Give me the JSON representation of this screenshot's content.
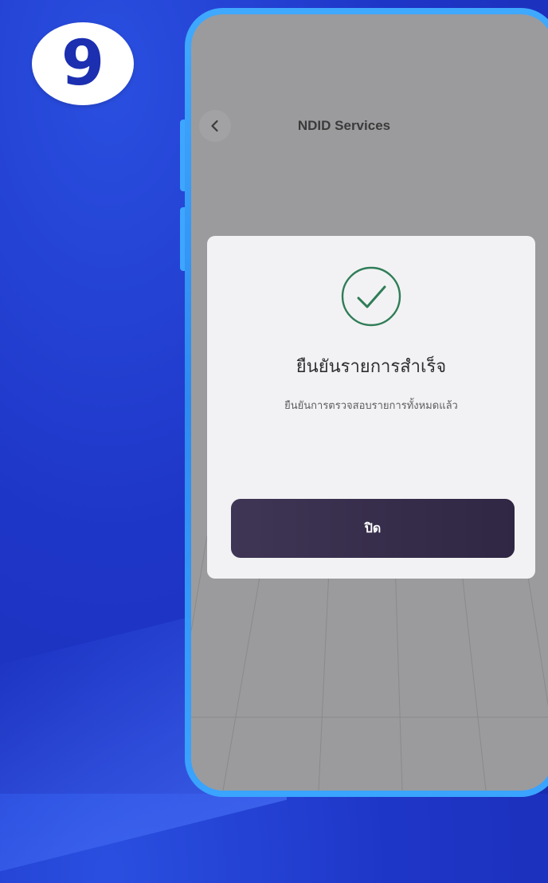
{
  "step": {
    "number": "9"
  },
  "screen": {
    "nav_title": "NDID Services",
    "back_icon": "chevron-left-icon"
  },
  "dialog": {
    "icon": "check-circle-icon",
    "title": "ยืนยันรายการสำเร็จ",
    "message": "ยืนยันการตรวจสอบรายการทั้งหมดแล้ว",
    "close_label": "ปิด"
  },
  "colors": {
    "background": "#1e36c8",
    "phone_frame": "#3ea6ff",
    "screen_overlay": "#9b9b9d",
    "dialog_bg": "#f2f2f4",
    "check_green": "#2f7d57",
    "button_bg": "#3a3150"
  }
}
